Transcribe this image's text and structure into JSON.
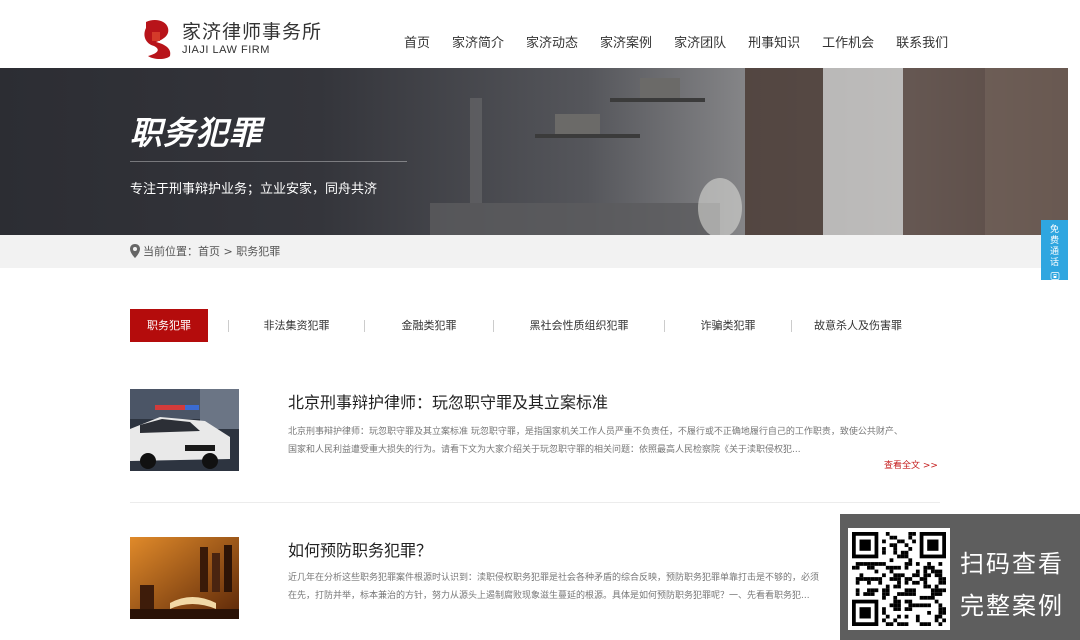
{
  "header": {
    "logo_cn": "家济律师事务所",
    "logo_en": "JIAJI LAW FIRM",
    "nav": [
      "首页",
      "家济简介",
      "家济动态",
      "家济案例",
      "家济团队",
      "刑事知识",
      "工作机会",
      "联系我们"
    ]
  },
  "banner": {
    "title": "职务犯罪",
    "subtitle": "专注于刑事辩护业务；立业安家，同舟共济"
  },
  "breadcrumb": {
    "text": "当前位置：首页 > 职务犯罪"
  },
  "float_call": {
    "text": "免费通话"
  },
  "tabs": [
    "职务犯罪",
    "非法集资犯罪",
    "金融类犯罪",
    "黑社会性质组织犯罪",
    "诈骗类犯罪",
    "故意杀人及伤害罪"
  ],
  "articles": [
    {
      "title": "北京刑事辩护律师：玩忽职守罪及其立案标准",
      "line1": "北京刑事辩护律师：玩忽职守罪及其立案标准 玩忽职守罪，是指国家机关工作人员严重不负责任，不履行或不正确地履行自己的工作职责，致使公共财产、",
      "line2": "国家和人民利益遭受重大损失的行为。请看下文为大家介绍关于玩忽职守罪的相关问题：依照最高人民检察院《关于渎职侵权犯...",
      "more": "查看全文 >>"
    },
    {
      "title": "如何预防职务犯罪？",
      "line1": "近几年在分析这些职务犯罪案件根源时认识到：渎职侵权职务犯罪是社会各种矛盾的综合反映，预防职务犯罪单靠打击是不够的，必须",
      "line2": "在先，打防并举，标本兼治的方针，努力从源头上遏制腐败现象滋生蔓延的根源。具体是如何预防职务犯罪呢？一、先看看职务犯..."
    }
  ],
  "qr": {
    "line1": "扫码查看",
    "line2": "完整案例"
  },
  "colors": {
    "accent": "#b40c0c",
    "float": "#2fa6e0"
  }
}
